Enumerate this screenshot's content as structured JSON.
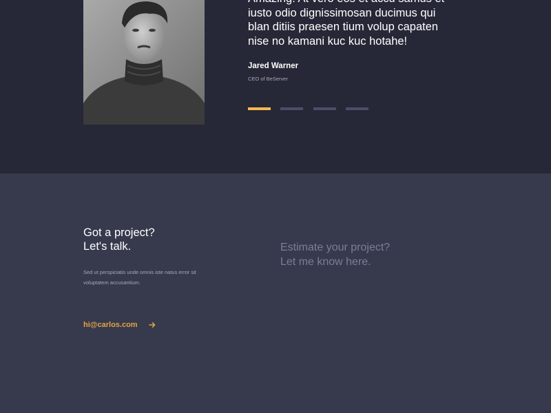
{
  "testimonial": {
    "quote_lines": [
      "Amazing! At vero eos et accu samus et",
      "iusto odio dignissimosan ducimus qui",
      "blan ditiis praesen tium volup capaten",
      "nise no kamani kuc kuc hotahe!"
    ],
    "author_name": "Jared Warner",
    "author_role": "CEO of BeServer",
    "slider": {
      "count": 4,
      "active_index": 0,
      "active_color": "#ffb84d",
      "inactive_color": "#4b4e68"
    }
  },
  "contact": {
    "title_lines": [
      "Got a project?",
      "Let's talk."
    ],
    "description": "Sed ut perspiciatis unde omnis iste natus error sit voluptatem accusantium.",
    "email": "hi@carlos.com",
    "arrow_icon": "arrow-right-icon"
  },
  "estimate": {
    "title_lines": [
      "Estimate your project?",
      "Let me know here."
    ]
  },
  "colors": {
    "testimonial_bg": "#262837",
    "contact_bg": "#373a4d",
    "accent": "#e0a444"
  }
}
